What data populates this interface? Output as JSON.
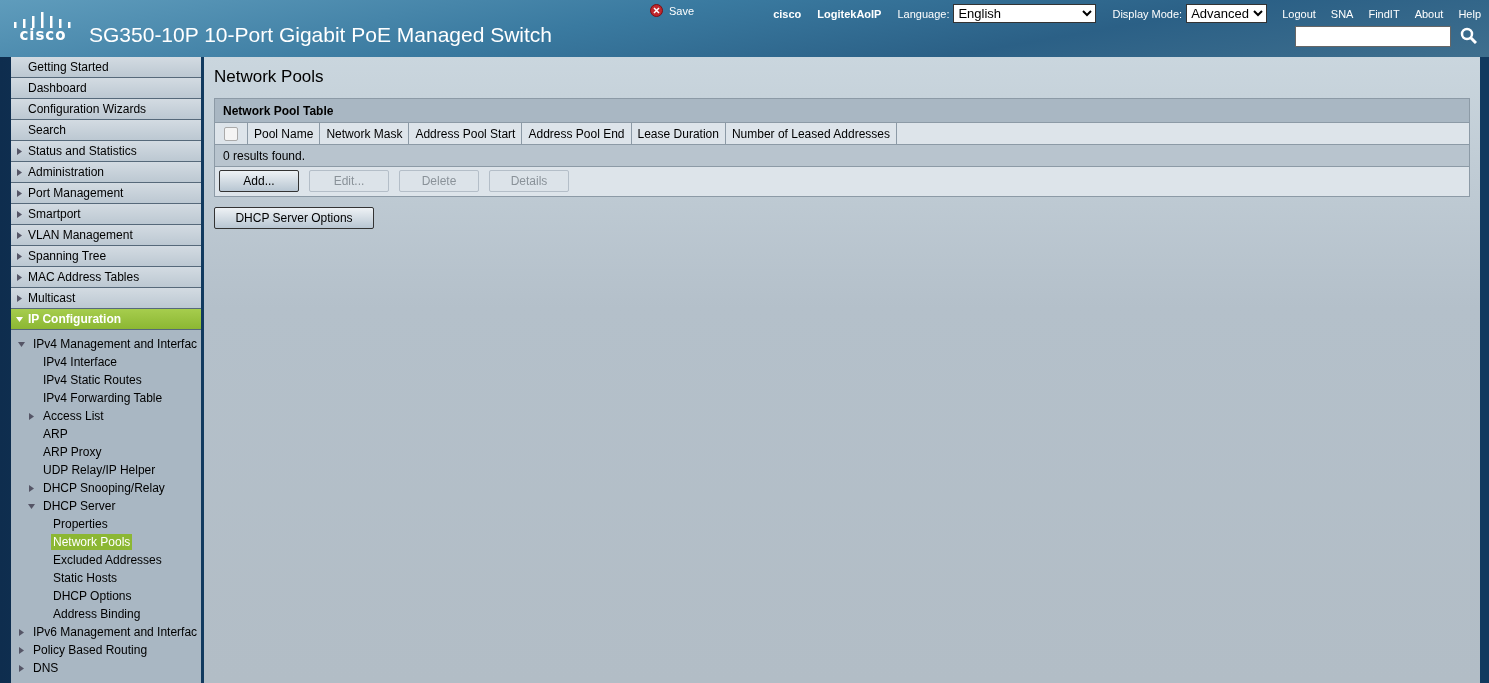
{
  "header": {
    "logo": "cisco",
    "title": "SG350-10P 10-Port Gigabit PoE Managed Switch",
    "save": "Save",
    "user": "cisco",
    "device": "LogitekAoIP",
    "language_label": "Language:",
    "language": "English",
    "display_mode_label": "Display Mode:",
    "display_mode": "Advanced",
    "links": [
      "Logout",
      "SNA",
      "FindIT",
      "About",
      "Help"
    ]
  },
  "sidebar": {
    "items": [
      {
        "label": "Getting Started",
        "kind": "page",
        "selected": false
      },
      {
        "label": "Dashboard",
        "kind": "page",
        "selected": false
      },
      {
        "label": "Configuration Wizards",
        "kind": "page",
        "selected": false
      },
      {
        "label": "Search",
        "kind": "page",
        "selected": false
      },
      {
        "label": "Status and Statistics",
        "kind": "folder",
        "expanded": false,
        "selected": false
      },
      {
        "label": "Administration",
        "kind": "folder",
        "expanded": false,
        "selected": false
      },
      {
        "label": "Port Management",
        "kind": "folder",
        "expanded": false,
        "selected": false
      },
      {
        "label": "Smartport",
        "kind": "folder",
        "expanded": false,
        "selected": false
      },
      {
        "label": "VLAN Management",
        "kind": "folder",
        "expanded": false,
        "selected": false
      },
      {
        "label": "Spanning Tree",
        "kind": "folder",
        "expanded": false,
        "selected": false
      },
      {
        "label": "MAC Address Tables",
        "kind": "folder",
        "expanded": false,
        "selected": false
      },
      {
        "label": "Multicast",
        "kind": "folder",
        "expanded": false,
        "selected": false
      },
      {
        "label": "IP Configuration",
        "kind": "folder",
        "expanded": true,
        "selected": true,
        "children": [
          {
            "label": "IPv4 Management and Interfac",
            "kind": "folder",
            "expanded": true,
            "selected": false,
            "children": [
              {
                "label": "IPv4 Interface",
                "kind": "page",
                "selected": false
              },
              {
                "label": "IPv4 Static Routes",
                "kind": "page",
                "selected": false
              },
              {
                "label": "IPv4 Forwarding Table",
                "kind": "page",
                "selected": false
              },
              {
                "label": "Access List",
                "kind": "folder",
                "expanded": false,
                "selected": false
              },
              {
                "label": "ARP",
                "kind": "page",
                "selected": false
              },
              {
                "label": "ARP Proxy",
                "kind": "page",
                "selected": false
              },
              {
                "label": "UDP Relay/IP Helper",
                "kind": "page",
                "selected": false
              },
              {
                "label": "DHCP Snooping/Relay",
                "kind": "folder",
                "expanded": false,
                "selected": false
              },
              {
                "label": "DHCP Server",
                "kind": "folder",
                "expanded": true,
                "selected": false,
                "children": [
                  {
                    "label": "Properties",
                    "selected": false
                  },
                  {
                    "label": "Network Pools",
                    "selected": true
                  },
                  {
                    "label": "Excluded Addresses",
                    "selected": false
                  },
                  {
                    "label": "Static Hosts",
                    "selected": false
                  },
                  {
                    "label": "DHCP Options",
                    "selected": false
                  },
                  {
                    "label": "Address Binding",
                    "selected": false
                  }
                ]
              }
            ]
          },
          {
            "label": "IPv6 Management and Interfac",
            "kind": "folder",
            "expanded": false,
            "selected": false
          },
          {
            "label": "Policy Based Routing",
            "kind": "folder",
            "expanded": false,
            "selected": false
          },
          {
            "label": "DNS",
            "kind": "folder",
            "expanded": false,
            "selected": false
          }
        ]
      }
    ]
  },
  "page": {
    "title": "Network Pools",
    "table": {
      "title": "Network Pool Table",
      "select_all": {
        "checked": false
      },
      "columns": [
        "Pool Name",
        "Network Mask",
        "Address Pool Start",
        "Address Pool End",
        "Lease Duration",
        "Number of Leased Addresses"
      ],
      "status": "0 results found.",
      "buttons": [
        {
          "label": "Add...",
          "disabled": false
        },
        {
          "label": "Edit...",
          "disabled": true
        },
        {
          "label": "Delete",
          "disabled": true
        },
        {
          "label": "Details",
          "disabled": true
        }
      ]
    },
    "extra_button": "DHCP Server Options"
  }
}
